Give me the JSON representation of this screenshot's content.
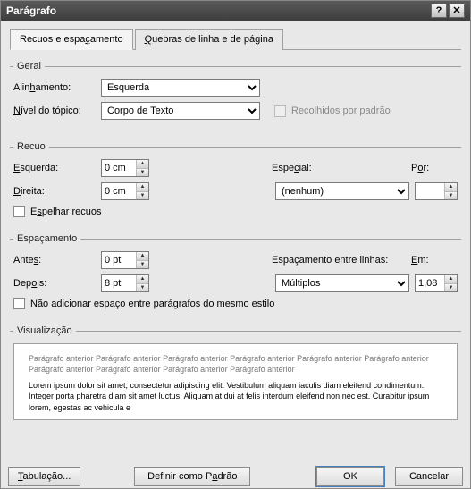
{
  "titlebar": {
    "title": "Parágrafo",
    "help": "?",
    "close": "✕"
  },
  "tabs": {
    "indent_spacing_pre": "Recuos e espa",
    "indent_spacing_u": "ç",
    "indent_spacing_post": "amento",
    "breaks_u": "Q",
    "breaks_post": "uebras de linha e de página"
  },
  "general": {
    "legend": "Geral",
    "align_label_pre": "Alin",
    "align_label_u": "h",
    "align_label_post": "amento:",
    "align_value": "Esquerda",
    "outline_label_u": "N",
    "outline_label_post": "ível do tópico:",
    "outline_value": "Corpo de Texto",
    "collapsed_label": "Recolhidos por padrão"
  },
  "indent": {
    "legend": "Recuo",
    "left_u": "E",
    "left_post": "squerda:",
    "left_value": "0 cm",
    "right_u": "D",
    "right_post": "ireita:",
    "right_value": "0 cm",
    "special_label_pre": "Espe",
    "special_label_u": "c",
    "special_label_post": "ial:",
    "special_value": "(nenhum)",
    "by_label_pre": "P",
    "by_label_u": "o",
    "by_label_post": "r:",
    "by_value": "",
    "mirror_pre": "E",
    "mirror_u": "s",
    "mirror_post": "pelhar recuos"
  },
  "spacing": {
    "legend": "Espaçamento",
    "before_label_pre": "Ante",
    "before_label_u": "s",
    "before_label_post": ":",
    "before_value": "0 pt",
    "after_label_pre": "Dep",
    "after_label_u": "o",
    "after_label_post": "is:",
    "after_value": "8 pt",
    "line_label": "Espaçamento entre linhas:",
    "line_value": "Múltiplos",
    "at_label_u": "E",
    "at_label_post": "m:",
    "at_value": "1,08",
    "nospace_pre": "Não adicionar espaço entre parágra",
    "nospace_u": "f",
    "nospace_post": "os do mesmo estilo"
  },
  "preview": {
    "legend": "Visualização",
    "prev_text": "Parágrafo anterior Parágrafo anterior Parágrafo anterior Parágrafo anterior Parágrafo anterior Parágrafo anterior Parágrafo anterior Parágrafo anterior Parágrafo anterior Parágrafo anterior",
    "sample_text": "Lorem ipsum dolor sit amet, consectetur adipiscing elit. Vestibulum aliquam iaculis diam eleifend condimentum. Integer porta pharetra diam sit amet luctus. Aliquam at dui at felis interdum eleifend non nec est. Curabitur ipsum lorem, egestas ac vehicula e"
  },
  "buttons": {
    "tabs_u": "T",
    "tabs_post": "abulação...",
    "default_pre": "Definir como P",
    "default_u": "a",
    "default_post": "drão",
    "ok": "OK",
    "cancel": "Cancelar"
  }
}
